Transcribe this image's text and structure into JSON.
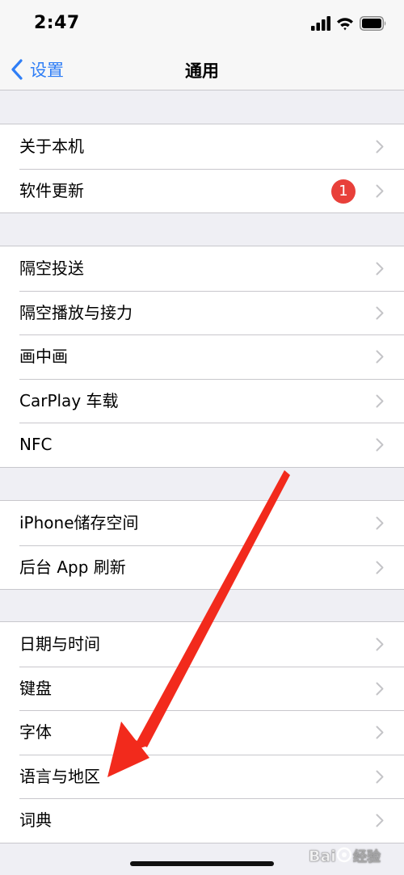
{
  "status_bar": {
    "time": "2:47"
  },
  "nav": {
    "back_label": "设置",
    "title": "通用"
  },
  "groups": [
    {
      "items": [
        {
          "label": "关于本机"
        },
        {
          "label": "软件更新",
          "badge": "1"
        }
      ]
    },
    {
      "items": [
        {
          "label": "隔空投送"
        },
        {
          "label": "隔空播放与接力"
        },
        {
          "label": "画中画"
        },
        {
          "label": "CarPlay 车载"
        },
        {
          "label": "NFC"
        }
      ]
    },
    {
      "items": [
        {
          "label": "iPhone储存空间"
        },
        {
          "label": "后台 App 刷新"
        }
      ]
    },
    {
      "items": [
        {
          "label": "日期与时间"
        },
        {
          "label": "键盘"
        },
        {
          "label": "字体"
        },
        {
          "label": "语言与地区"
        },
        {
          "label": "词典"
        }
      ]
    }
  ],
  "colors": {
    "accent": "#2f7ef6",
    "badge": "#e8403a",
    "annotation_arrow": "#f22a1c"
  },
  "icons": [
    "signal-icon",
    "wifi-icon",
    "battery-icon",
    "back-chevron-icon",
    "chevron-right-icon"
  ]
}
